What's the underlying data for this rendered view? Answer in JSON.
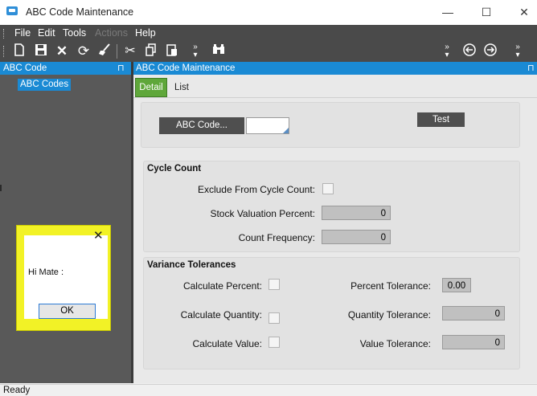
{
  "window": {
    "title": "ABC Code Maintenance",
    "minimize": "—",
    "maximize": "☐",
    "close": "✕"
  },
  "menu": {
    "file": "File",
    "edit": "Edit",
    "tools": "Tools",
    "actions": "Actions",
    "help": "Help"
  },
  "toolbar": {
    "icons": [
      "new-icon",
      "save-icon",
      "delete-icon",
      "refresh-icon",
      "clear-icon",
      "cut-icon",
      "copy-icon",
      "paste-icon",
      "overflow-icon",
      "binoculars-icon",
      "overflow-icon",
      "back-icon",
      "forward-icon",
      "overflow-icon"
    ]
  },
  "left_panel": {
    "title": "ABC Code",
    "pin": "⊓",
    "tree_item": "ABC Codes"
  },
  "right_panel": {
    "title": "ABC Code Maintenance",
    "pin": "⊓"
  },
  "tabs": {
    "detail": "Detail",
    "list": "List"
  },
  "top": {
    "abc_code_button": "ABC Code...",
    "abc_code_value": "",
    "test_button": "Test"
  },
  "cycle_count": {
    "title": "Cycle Count",
    "exclude_label": "Exclude From Cycle Count:",
    "stock_label": "Stock Valuation Percent:",
    "stock_value": "0",
    "frequency_label": "Count Frequency:",
    "frequency_value": "0"
  },
  "variance": {
    "title": "Variance Tolerances",
    "calc_percent_label": "Calculate Percent:",
    "calc_quantity_label": "Calculate Quantity:",
    "calc_value_label": "Calculate Value:",
    "percent_tol_label": "Percent Tolerance:",
    "percent_tol_value": "0.00",
    "quantity_tol_label": "Quantity Tolerance:",
    "quantity_tol_value": "0",
    "value_tol_label": "Value Tolerance:",
    "value_tol_value": "0"
  },
  "dialog": {
    "message": "Hi Mate :",
    "ok": "OK",
    "close": "✕"
  },
  "status": {
    "text": "Ready"
  },
  "colors": {
    "accent": "#1a8ad4",
    "tab_active": "#5fa73a",
    "dialog_border": "#f2f226",
    "dark_bar": "#4a4a4a"
  }
}
